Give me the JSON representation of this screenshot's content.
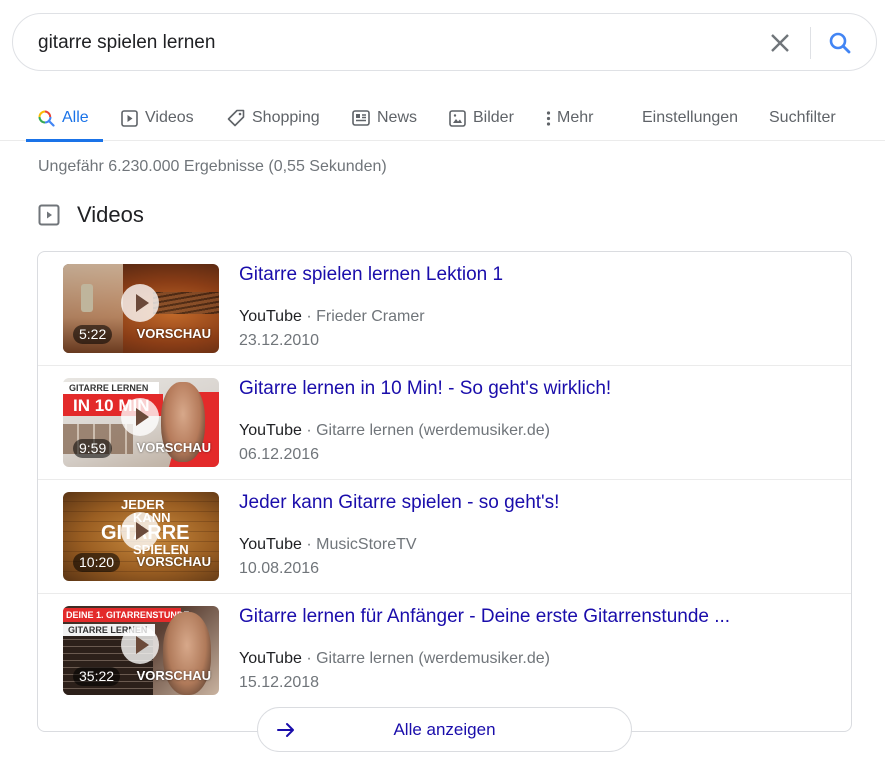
{
  "search": {
    "query": "gitarre spielen lernen",
    "clear_icon": "close-icon",
    "search_icon": "search-icon"
  },
  "tabs": [
    {
      "label": "Alle",
      "icon": "search-icon",
      "active": true
    },
    {
      "label": "Videos",
      "icon": "video-icon",
      "active": false
    },
    {
      "label": "Shopping",
      "icon": "tag-icon",
      "active": false
    },
    {
      "label": "News",
      "icon": "newspaper-icon",
      "active": false
    },
    {
      "label": "Bilder",
      "icon": "image-icon",
      "active": false
    },
    {
      "label": "Mehr",
      "icon": "more-vertical-icon",
      "active": false
    },
    {
      "label": "Einstellungen",
      "active": false
    },
    {
      "label": "Suchfilter",
      "active": false
    }
  ],
  "stats": "Ungefähr 6.230.000 Ergebnisse (0,55 Sekunden)",
  "videos_section": {
    "title": "Videos",
    "icon": "video-icon",
    "items": [
      {
        "title": "Gitarre spielen lernen Lektion 1",
        "platform": "YouTube",
        "separator": "·",
        "channel": "Frieder Cramer",
        "date": "23.12.2010",
        "duration": "5:22",
        "preview_label": "VORSCHAU",
        "overlay_text": []
      },
      {
        "title": "Gitarre lernen in 10 Min! - So geht's wirklich!",
        "platform": "YouTube",
        "separator": "·",
        "channel": "Gitarre lernen (werdemusiker.de)",
        "date": "06.12.2016",
        "duration": "9:59",
        "preview_label": "VORSCHAU",
        "overlay_text": [
          "GITARRE LERNEN",
          "IN 10 MIN"
        ]
      },
      {
        "title": "Jeder kann Gitarre spielen - so geht's!",
        "platform": "YouTube",
        "separator": "·",
        "channel": "MusicStoreTV",
        "date": "10.08.2016",
        "duration": "10:20",
        "preview_label": "VORSCHAU",
        "overlay_text": [
          "JEDER",
          "KANN",
          "GITARRE",
          "SPIELEN"
        ]
      },
      {
        "title": "Gitarre lernen für Anfänger - Deine erste Gitarrenstunde ...",
        "platform": "YouTube",
        "separator": "·",
        "channel": "Gitarre lernen (werdemusiker.de)",
        "date": "15.12.2018",
        "duration": "35:22",
        "preview_label": "VORSCHAU",
        "overlay_text": [
          "DEINE 1. GITARRENSTUNDE",
          "GITARRE LERNEN"
        ]
      }
    ],
    "show_all_label": "Alle anzeigen",
    "show_all_icon": "arrow-right-icon"
  },
  "colors": {
    "accent": "#1a73e8",
    "link": "#1a0dab",
    "secondary_text": "#70757a"
  }
}
